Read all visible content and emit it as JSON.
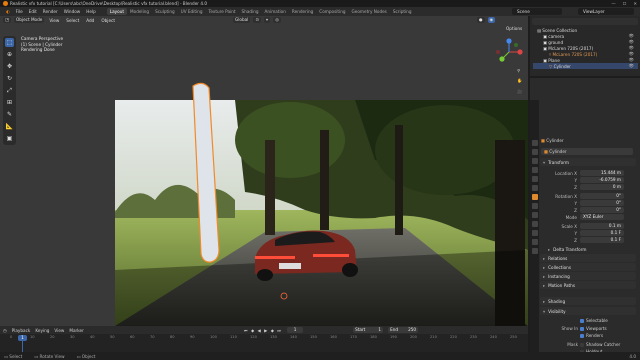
{
  "window": {
    "title": "Realistic vfx tutorial [C:\\Users\\abc\\OneDrive\\Desktop\\Realistic vfx tutorial.blend] - Blender 4.0",
    "controls": [
      "—",
      "☐",
      "✕"
    ]
  },
  "menu": {
    "items": [
      "File",
      "Edit",
      "Render",
      "Window",
      "Help"
    ],
    "workspaces": [
      "Layout",
      "Modeling",
      "Sculpting",
      "UV Editing",
      "Texture Paint",
      "Shading",
      "Animation",
      "Rendering",
      "Compositing",
      "Geometry Nodes",
      "Scripting"
    ],
    "active_workspace": "Layout",
    "scene": "Scene",
    "view_layer": "ViewLayer"
  },
  "viewport": {
    "mode": "Object Mode",
    "menus": [
      "View",
      "Select",
      "Add",
      "Object"
    ],
    "transform_orientation": "Global",
    "options_label": "Options",
    "info": [
      "Camera Perspective",
      "(1) Scene | Cylinder",
      "Rendering Done"
    ],
    "gizmo_axes": [
      "X",
      "Y",
      "Z"
    ]
  },
  "outliner": {
    "rows": [
      {
        "label": "Scene Collection",
        "indent": 0
      },
      {
        "label": "camera",
        "indent": 1
      },
      {
        "label": "ground",
        "indent": 1
      },
      {
        "label": "McLaren 720S (2017)",
        "indent": 1
      },
      {
        "label": "McLaren 720S (2017)",
        "indent": 2
      },
      {
        "label": "Plane",
        "indent": 1
      },
      {
        "label": "Cylinder",
        "indent": 2
      }
    ]
  },
  "properties": {
    "object_name": "Cylinder",
    "object_field": "Cylinder",
    "transform": {
      "title": "Transform",
      "location_label": "Location X",
      "location": [
        "15.444 m",
        "-6.0759 m",
        "0 m"
      ],
      "rotation_label": "Rotation X",
      "rotation": [
        "0°",
        "0°",
        "0°"
      ],
      "mode_label": "Mode",
      "mode": "XYZ Euler",
      "scale_label": "Scale X",
      "scale": [
        "0.1 m",
        "0.1 F",
        "0.1 F"
      ],
      "axis_labels": [
        "Y",
        "Z"
      ]
    },
    "sections": [
      "Delta Transform",
      "Relations",
      "Collections",
      "Instancing",
      "Motion Paths",
      "Shading",
      "Visibility"
    ],
    "visibility": {
      "selectable": "Selectable",
      "show_in_label": "Show In",
      "viewports": "Viewports",
      "renders": "Renders",
      "mask_label": "Mask",
      "shadow_catcher": "Shadow Catcher",
      "holdout": "Holdout"
    }
  },
  "timeline": {
    "menus": [
      "Playback",
      "Keying",
      "View",
      "Marker"
    ],
    "start_label": "Start",
    "start": "1",
    "end_label": "End",
    "end": "250",
    "current_frame": "1",
    "ticks": [
      "0",
      "10",
      "20",
      "30",
      "40",
      "50",
      "60",
      "70",
      "80",
      "90",
      "100",
      "110",
      "120",
      "130",
      "140",
      "150",
      "160",
      "170",
      "180",
      "190",
      "200",
      "210",
      "220",
      "230",
      "240",
      "250"
    ]
  },
  "status": {
    "select": "Select",
    "rotate": "Rotate View",
    "object": "Object",
    "version": "4.0"
  },
  "colors": {
    "accent_blue": "#3b67a8",
    "active_orange": "#e08a2e",
    "blender_orange": "#e87d0d"
  }
}
